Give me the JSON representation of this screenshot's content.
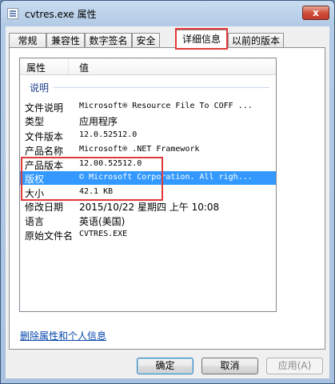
{
  "window": {
    "title": "cvtres.exe 属性",
    "close_glyph": "x"
  },
  "tabs": [
    {
      "label": "常规"
    },
    {
      "label": "兼容性"
    },
    {
      "label": "数字签名"
    },
    {
      "label": "安全"
    },
    {
      "label": "详细信息",
      "active": true
    },
    {
      "label": "以前的版本"
    }
  ],
  "list": {
    "col_property": "属性",
    "col_value": "值",
    "group_label": "说明",
    "rows": [
      {
        "key": "文件说明",
        "value": "Microsoft® Resource File To COFF ..."
      },
      {
        "key": "类型",
        "value": "应用程序"
      },
      {
        "key": "文件版本",
        "value": "12.0.52512.0"
      },
      {
        "key": "产品名称",
        "value": "Microsoft® .NET Framework"
      },
      {
        "key": "产品版本",
        "value": "12.00.52512.0"
      },
      {
        "key": "版权",
        "value": "© Microsoft Corporation. All righ..."
      },
      {
        "key": "大小",
        "value": "42.1 KB"
      },
      {
        "key": "修改日期",
        "value": "2015/10/22 星期四 上午 10:08"
      },
      {
        "key": "语言",
        "value": "英语(美国)"
      },
      {
        "key": "原始文件名",
        "value": "CVTRES.EXE"
      }
    ]
  },
  "link_label": "删除属性和个人信息",
  "buttons": {
    "ok": "确定",
    "cancel": "取消",
    "apply": "应用(A)"
  },
  "colors": {
    "selection": "#3399ff",
    "highlight_annotation": "#e23a3a",
    "link": "#0645ad"
  }
}
